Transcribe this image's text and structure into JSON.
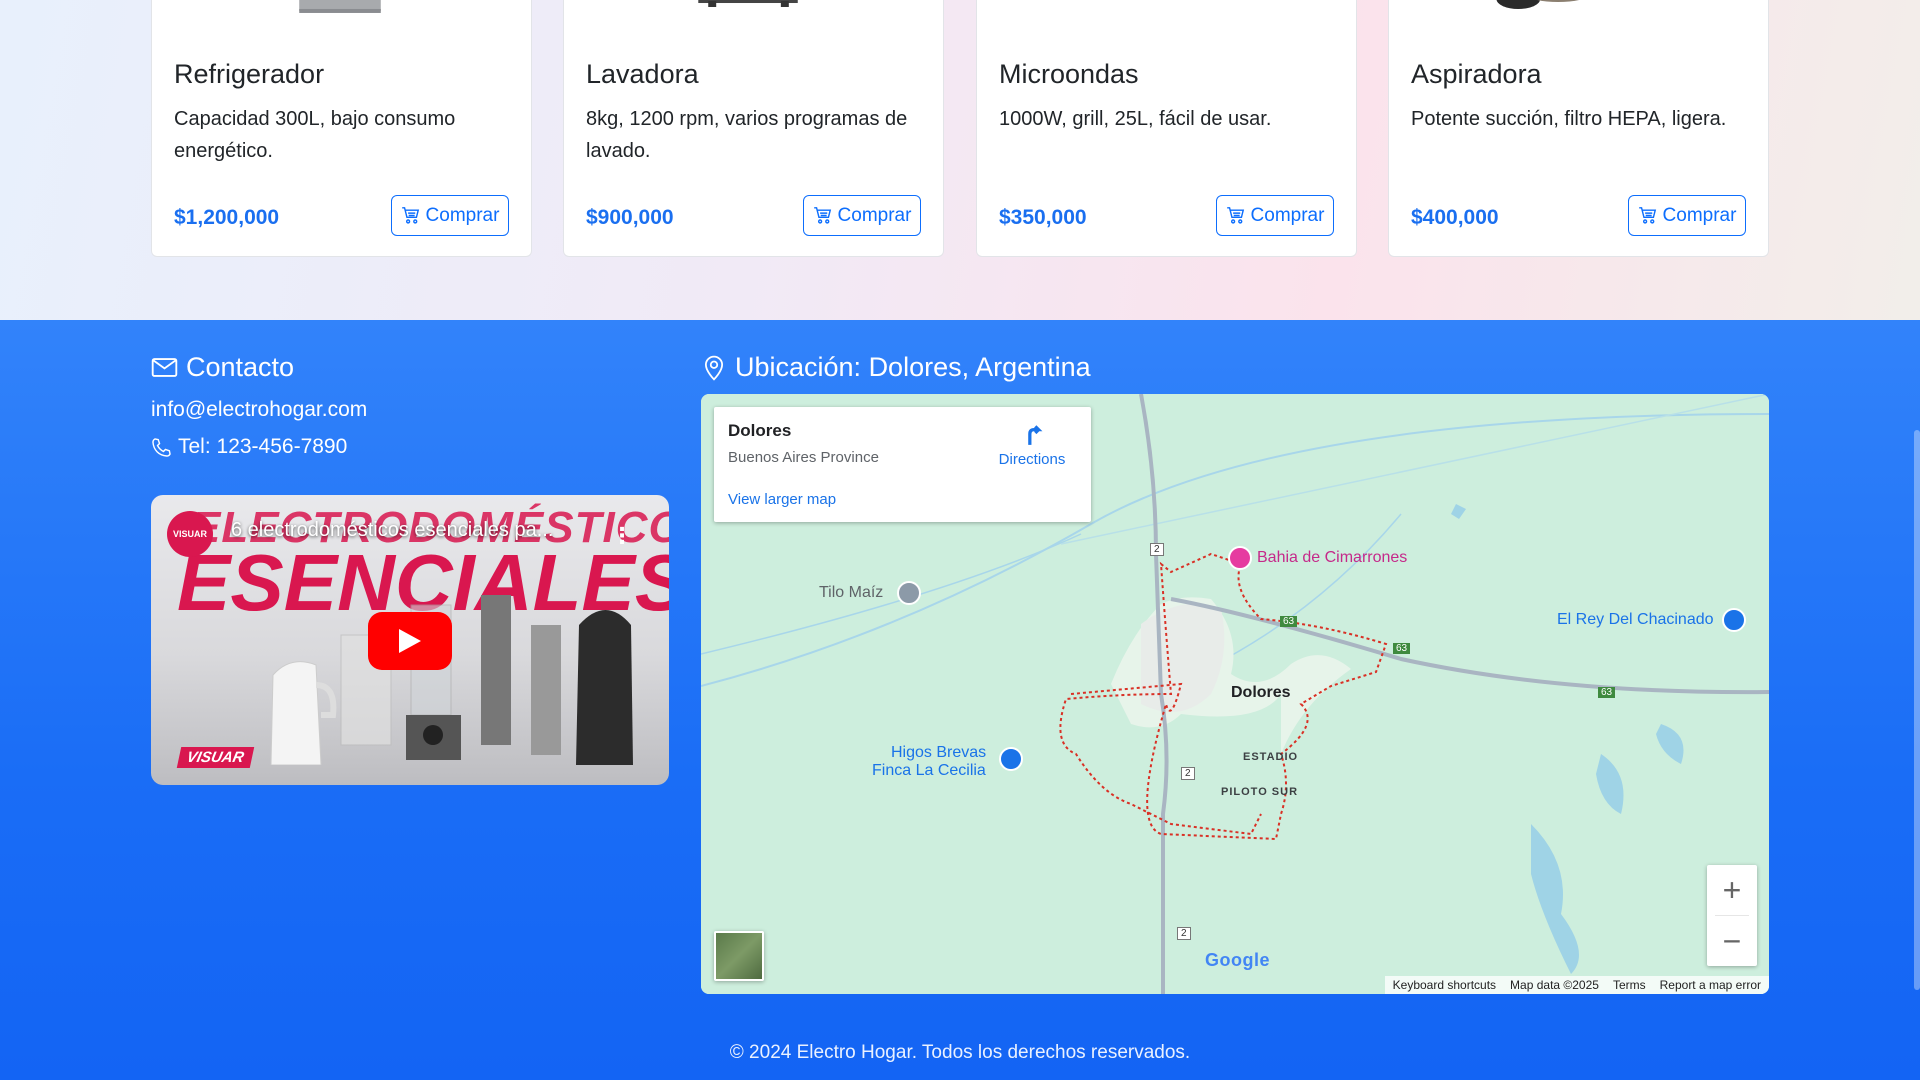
{
  "products": [
    {
      "title": "Refrigerador",
      "description": "Capacidad 300L, bajo consumo energético.",
      "price": "$1,200,000",
      "button": "Comprar"
    },
    {
      "title": "Lavadora",
      "description": "8kg, 1200 rpm, varios programas de lavado.",
      "price": "$900,000",
      "button": "Comprar"
    },
    {
      "title": "Microondas",
      "description": "1000W, grill, 25L, fácil de usar.",
      "price": "$350,000",
      "button": "Comprar"
    },
    {
      "title": "Aspiradora",
      "description": "Potente succión, filtro HEPA, ligera.",
      "price": "$400,000",
      "button": "Comprar"
    }
  ],
  "contact": {
    "heading": "Contacto",
    "email": "info@electrohogar.com",
    "phone": "Tel: 123-456-7890"
  },
  "video": {
    "title": "6 electrodomésticos esenciales pa...",
    "overlay_line1": "ELECTRODOMÉSTICOS",
    "overlay_line2": "ESENCIALES",
    "channel_badge": "VISUAR",
    "brand_tag": "VISUAR"
  },
  "location": {
    "heading": "Ubicación: Dolores, Argentina"
  },
  "map": {
    "place_name": "Dolores",
    "place_region": "Buenos Aires Province",
    "directions_label": "Directions",
    "larger_map_label": "View larger map",
    "labels": {
      "tilo": "Tilo Maíz",
      "bahia": "Bahia de Cimarrones",
      "rey": "El Rey Del Chacinado",
      "higos1": "Higos Brevas",
      "higos2": "Finca La Cecilia",
      "dolores": "Dolores",
      "estadio": "ESTADIO",
      "piloto": "PILOTO SUR"
    },
    "route_markers": [
      "2",
      "63",
      "63",
      "63",
      "2",
      "2"
    ],
    "zoom_in": "+",
    "zoom_out": "−",
    "google": "Google",
    "footer_links": [
      "Keyboard shortcuts",
      "Map data ©2025",
      "Terms",
      "Report a map error"
    ]
  },
  "copyright": "© 2024 Electro Hogar. Todos los derechos reservados.",
  "colors": {
    "primary": "#0d6efd",
    "price": "#1a6ff0",
    "footer": "#1a6df6",
    "map_bg": "#cfeede"
  }
}
